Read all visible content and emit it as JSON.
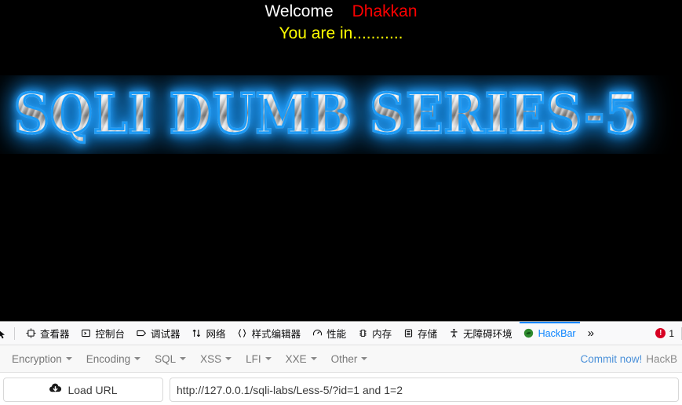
{
  "page": {
    "welcome_label": "Welcome",
    "user_name": "Dhakkan",
    "status_line": "You are in...........",
    "banner_text": "SQLI DUMB SERIES-5",
    "colors": {
      "background": "#000000",
      "welcome": "#ffffff",
      "user_name": "#ff0000",
      "status_line": "#ffff00",
      "banner_glow": "#1d9bf6"
    }
  },
  "devtools": {
    "picker_icon": "element-picker-icon",
    "tabs": [
      {
        "label": "查看器",
        "icon": "inspector-icon",
        "active": false
      },
      {
        "label": "控制台",
        "icon": "console-icon",
        "active": false
      },
      {
        "label": "调试器",
        "icon": "debugger-icon",
        "active": false
      },
      {
        "label": "网络",
        "icon": "network-icon",
        "active": false
      },
      {
        "label": "样式编辑器",
        "icon": "style-editor-icon",
        "active": false
      },
      {
        "label": "性能",
        "icon": "performance-icon",
        "active": false
      },
      {
        "label": "内存",
        "icon": "memory-icon",
        "active": false
      },
      {
        "label": "存储",
        "icon": "storage-icon",
        "active": false
      },
      {
        "label": "无障碍环境",
        "icon": "accessibility-icon",
        "active": false
      },
      {
        "label": "HackBar",
        "icon": "hackbar-icon",
        "active": true
      }
    ],
    "overflow_glyph": "»",
    "error_count": "1",
    "error_icon": "error-badge-icon",
    "active_tab_color": "#0a84ff",
    "error_color": "#d70022"
  },
  "hackbar": {
    "menus": [
      {
        "label": "Encryption"
      },
      {
        "label": "Encoding"
      },
      {
        "label": "SQL"
      },
      {
        "label": "XSS"
      },
      {
        "label": "LFI"
      },
      {
        "label": "XXE"
      },
      {
        "label": "Other"
      }
    ],
    "commit_link": "Commit now!",
    "commit_suffix": "HackB",
    "load_url_label": "Load URL",
    "load_url_icon": "cloud-download-icon",
    "url_value": "http://127.0.0.1/sqli-labs/Less-5/?id=1 and 1=2",
    "url_placeholder": "URL",
    "link_color": "#4a90d9"
  }
}
